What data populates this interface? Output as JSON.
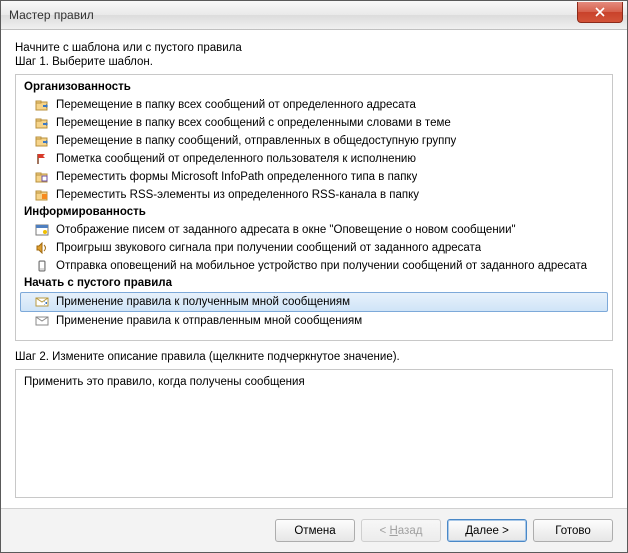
{
  "window": {
    "title": "Мастер правил"
  },
  "intro": "Начните с шаблона или с пустого правила",
  "step1": "Шаг 1. Выберите шаблон.",
  "groups": {
    "org": {
      "title": "Организованность",
      "items": [
        {
          "icon": "folder-move",
          "label": "Перемещение в папку всех сообщений от определенного адресата"
        },
        {
          "icon": "folder-move",
          "label": "Перемещение в папку всех сообщений с определенными словами в теме"
        },
        {
          "icon": "folder-move",
          "label": "Перемещение в папку сообщений, отправленных в общедоступную группу"
        },
        {
          "icon": "flag-red",
          "label": "Пометка сообщений от определенного пользователя к исполнению"
        },
        {
          "icon": "folder-form",
          "label": "Переместить формы Microsoft InfoPath определенного типа в папку"
        },
        {
          "icon": "folder-rss",
          "label": "Переместить RSS-элементы из определенного RSS-канала в папку"
        }
      ]
    },
    "info": {
      "title": "Информированность",
      "items": [
        {
          "icon": "alert-window",
          "label": "Отображение писем от заданного адресата в окне \"Оповещение о новом сообщении\""
        },
        {
          "icon": "sound",
          "label": "Проигрыш звукового сигнала при получении сообщений от заданного адресата"
        },
        {
          "icon": "mobile",
          "label": "Отправка оповещений на мобильное устройство при получении сообщений от заданного адресата"
        }
      ]
    },
    "blank": {
      "title": "Начать с пустого правила",
      "items": [
        {
          "icon": "mail-in",
          "label": "Применение правила к полученным мной сообщениям",
          "selected": true
        },
        {
          "icon": "mail-out",
          "label": "Применение правила к отправленным мной сообщениям"
        }
      ]
    }
  },
  "step2": "Шаг 2. Измените описание правила (щелкните подчеркнутое значение).",
  "description": "Применить это правило, когда получены сообщения",
  "buttons": {
    "cancel": "Отмена",
    "back_prefix": "< ",
    "back_letter": "Н",
    "back_suffix": "азад",
    "next_letter": "Д",
    "next_suffix": "алее >",
    "finish": "Готово"
  }
}
